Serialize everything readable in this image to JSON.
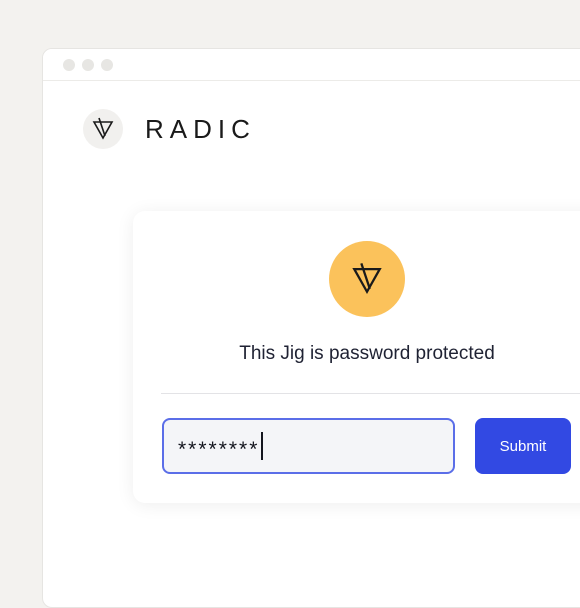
{
  "brand": {
    "name": "RADIC",
    "logo_icon": "triangle-v-logo-icon"
  },
  "card": {
    "badge_icon": "triangle-v-logo-icon",
    "message": "This Jig is password protected",
    "password_input": {
      "value": "********"
    },
    "submit_label": "Submit"
  },
  "colors": {
    "accent": "#3249e3",
    "badge": "#fbc25b",
    "input_border": "#5b6ee8",
    "text_dark": "#1f2233"
  }
}
